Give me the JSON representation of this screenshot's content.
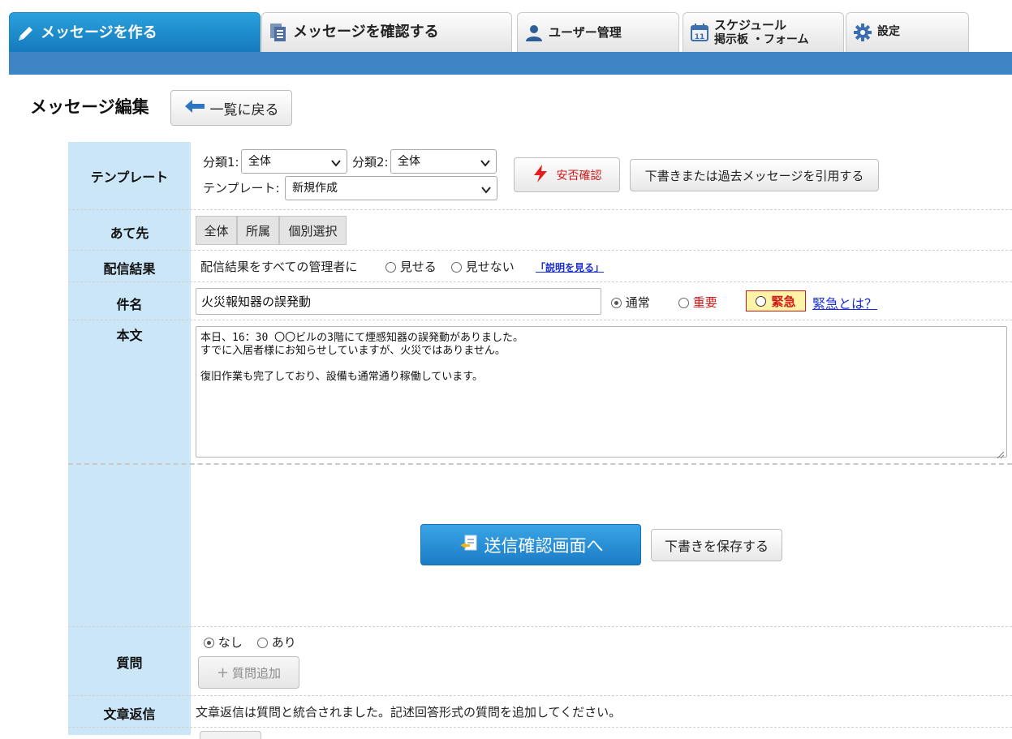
{
  "tabs": [
    {
      "label": "メッセージを作る",
      "active": true
    },
    {
      "label": "メッセージを確認する",
      "active": false
    },
    {
      "label": "ユーザー管理",
      "active": false
    },
    {
      "label": "スケジュール",
      "label2": "掲示板 ・フォーム",
      "active": false
    },
    {
      "label": "設定",
      "active": false
    }
  ],
  "page": {
    "title": "メッセージ編集",
    "back_label": "一覧に戻る"
  },
  "template": {
    "label": "テンプレート",
    "cat1_label": "分類1:",
    "cat1_value": "全体",
    "cat2_label": "分類2:",
    "cat2_value": "全体",
    "tpl_label": "テンプレート:",
    "tpl_value": "新規作成",
    "safety_btn": "安否確認",
    "quote_btn": "下書きまたは過去メッセージを引用する"
  },
  "recipient": {
    "label": "あて先",
    "options": [
      "全体",
      "所属",
      "個別選択"
    ]
  },
  "delivery": {
    "label": "配信結果",
    "text": "配信結果をすべての管理者に",
    "show": "見せる",
    "hide": "見せない",
    "help_link": "「説明を見る」"
  },
  "subject": {
    "label": "件名",
    "value": "火災報知器の誤発動",
    "priority_normal": "通常",
    "priority_important": "重要",
    "priority_urgent": "緊急",
    "urgent_help": "緊急とは？",
    "selected": "通常"
  },
  "body": {
    "label": "本文",
    "text": "本日、16：30 〇〇ビルの3階にて煙感知器の誤発動がありました。\nすでに入居者様にお知らせしていますが、火災ではありません。\n\n復旧作業も完了しており、設備も通常通り稼働しています。"
  },
  "actions": {
    "send_confirm": "送信確認画面へ",
    "save_draft": "下書きを保存する"
  },
  "question": {
    "label": "質問",
    "none": "なし",
    "yes": "あり",
    "selected": "なし",
    "add_btn": "質問追加"
  },
  "text_reply": {
    "label": "文章返信",
    "text": "文章返信は質問と統合されました。記述回答形式の質問を追加してください。"
  },
  "colors": {
    "accent_blue": "#3f84c4",
    "label_bg": "#cbe6f7",
    "urgent_bg": "#fff3a8",
    "urgent_text": "#d01919"
  }
}
